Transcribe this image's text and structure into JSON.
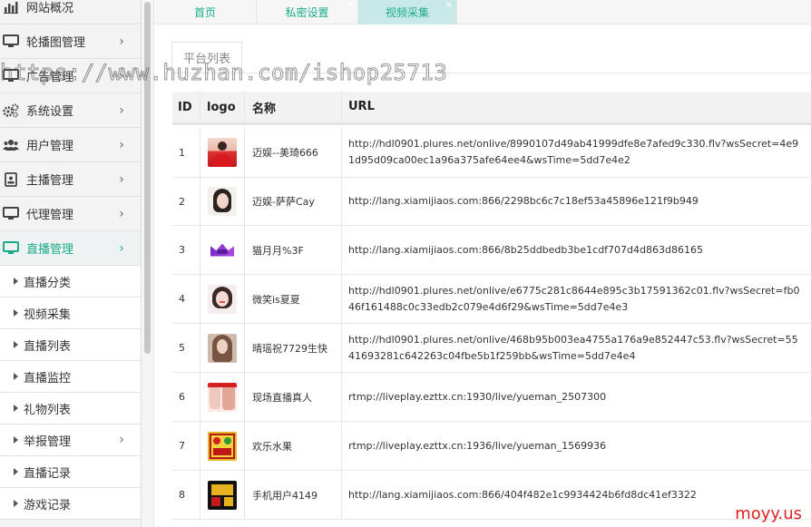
{
  "sidebar": {
    "items": [
      {
        "label": "网站概况",
        "icon": "bar-chart-icon",
        "arrow": ""
      },
      {
        "label": "轮播图管理",
        "icon": "monitor-icon",
        "arrow": "›"
      },
      {
        "label": "广告管理",
        "icon": "monitor-icon",
        "arrow": "›"
      },
      {
        "label": "系统设置",
        "icon": "gears-icon",
        "arrow": "›"
      },
      {
        "label": "用户管理",
        "icon": "users-icon",
        "arrow": "›"
      },
      {
        "label": "主播管理",
        "icon": "id-card-icon",
        "arrow": "›"
      },
      {
        "label": "代理管理",
        "icon": "monitor-icon",
        "arrow": "›"
      },
      {
        "label": "直播管理",
        "icon": "monitor-icon",
        "arrow": "›",
        "active": true
      }
    ],
    "sub_items": [
      {
        "label": "直播分类",
        "arrow": ""
      },
      {
        "label": "视频采集",
        "arrow": ""
      },
      {
        "label": "直播列表",
        "arrow": ""
      },
      {
        "label": "直播监控",
        "arrow": ""
      },
      {
        "label": "礼物列表",
        "arrow": ""
      },
      {
        "label": "举报管理",
        "arrow": "›"
      },
      {
        "label": "直播记录",
        "arrow": ""
      },
      {
        "label": "游戏记录",
        "arrow": ""
      }
    ]
  },
  "tabs": [
    {
      "label": "首页",
      "close": ""
    },
    {
      "label": "私密设置",
      "close": "×"
    },
    {
      "label": "视频采集",
      "close": "×",
      "active": true
    }
  ],
  "panel": {
    "tab_label": "平台列表"
  },
  "table": {
    "headers": {
      "id": "ID",
      "logo": "logo",
      "name": "名称",
      "url": "URL"
    },
    "rows": [
      {
        "id": "1",
        "name": "迈娱--美琦666",
        "url": "http://hdl0901.plures.net/onlive/8990107d49ab41999dfe8e7afed9c330.flv?wsSecret=4e91d95d09ca00ec1a96a375afe64ee4&wsTime=5dd7e4e2",
        "logo": "logo-red-dress"
      },
      {
        "id": "2",
        "name": "迈娱-萨萨Cay",
        "url": "http://lang.xiamijiaos.com:866/2298bc6c7c18ef53a45896e121f9b949",
        "logo": "logo-portrait-girl"
      },
      {
        "id": "3",
        "name": "猫月月%3F",
        "url": "http://lang.xiamijiaos.com:866/8b25ddbedb3be1cdf707d4d863d86165",
        "logo": "logo-purple-crown"
      },
      {
        "id": "4",
        "name": "微笑is夏夏",
        "url": "http://hdl0901.plures.net/onlive/e6775c281c8644e895c3b17591362c01.flv?wsSecret=fb046f161488c0c33edb2c079e4d6f29&wsTime=5dd7e4e3",
        "logo": "logo-portrait-smile"
      },
      {
        "id": "5",
        "name": "晴瑶祝7729生快",
        "url": "http://hdl0901.plures.net/onlive/468b95b003ea4755a176a9e852447c53.flv?wsSecret=5541693281c642263c04fbe5b1f259bb&wsTime=5dd7e4e4",
        "logo": "logo-portrait-brown"
      },
      {
        "id": "6",
        "name": "现场直播真人",
        "url": "rtmp://liveplay.ezttx.cn:1930/live/yueman_2507300",
        "logo": "logo-poster-red"
      },
      {
        "id": "7",
        "name": "欢乐水果",
        "url": "rtmp://liveplay.ezttx.cn:1936/live/yueman_1569936",
        "logo": "logo-fruit-game"
      },
      {
        "id": "8",
        "name": "手机用户4149",
        "url": "http://lang.xiamijiaos.com:866/404f482e1c9934424b6fd8dc41ef3322",
        "logo": "logo-dark-game"
      }
    ]
  },
  "watermarks": {
    "huzhan": "https://www.huzhan.com/ishop25713",
    "moyy": "moyy.us"
  },
  "colors": {
    "accent": "#1aab8a",
    "active_tab_bg": "#c9e9e9",
    "watermark_red": "#e02020"
  }
}
